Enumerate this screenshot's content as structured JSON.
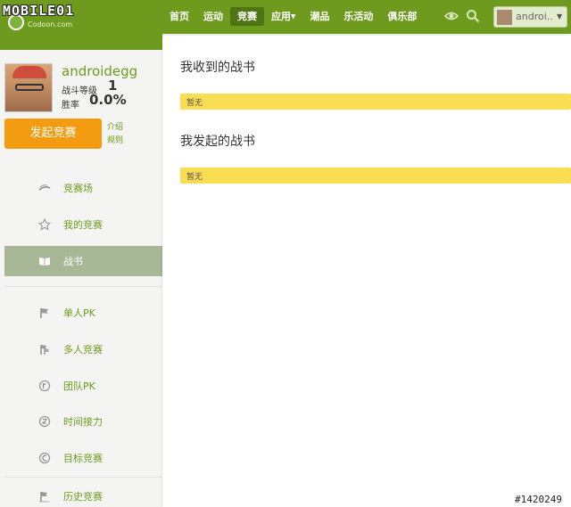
{
  "header": {
    "logo_text": "MOBILE01",
    "logo_sub": "Codoon.com",
    "nav": [
      {
        "label": "首页"
      },
      {
        "label": "运动"
      },
      {
        "label": "竞赛"
      },
      {
        "label": "应用"
      },
      {
        "label": "潮品"
      },
      {
        "label": "乐活动"
      },
      {
        "label": "俱乐部"
      }
    ],
    "active_nav": "竞赛",
    "user_label": "androi...",
    "icons": [
      "eye-icon",
      "search-icon"
    ]
  },
  "profile": {
    "username": "androidegg",
    "rank_label": "战斗等级",
    "rank_value": "1",
    "win_label": "胜率",
    "win_value": "0.0%",
    "launch_button": "发起竞赛",
    "intro_link": "介绍",
    "rules_link": "规则"
  },
  "sidebar": {
    "items": [
      {
        "label": "竞赛场",
        "icon": "arena-icon"
      },
      {
        "label": "我的竞赛",
        "icon": "star-icon"
      },
      {
        "label": "战书",
        "icon": "book-icon",
        "active": true
      },
      {
        "label": "单人PK",
        "icon": "flag-icon"
      },
      {
        "label": "多人竞赛",
        "icon": "multi-flag-icon"
      },
      {
        "label": "团队PK",
        "icon": "team-flag-icon"
      },
      {
        "label": "时间接力",
        "icon": "relay-icon"
      },
      {
        "label": "目标竞赛",
        "icon": "target-icon"
      },
      {
        "label": "历史竞赛",
        "icon": "history-flag-icon"
      }
    ]
  },
  "main": {
    "received_title": "我收到的战书",
    "received_empty": "暂无",
    "sent_title": "我发起的战书",
    "sent_empty": "暂无"
  },
  "watermark": "#1420249",
  "colors": {
    "brand_green": "#6e9b1e",
    "active_nav": "#4e7414",
    "launch_orange": "#f39c12",
    "notice_yellow": "#f9dd53",
    "active_sidebar": "#a8b796"
  }
}
